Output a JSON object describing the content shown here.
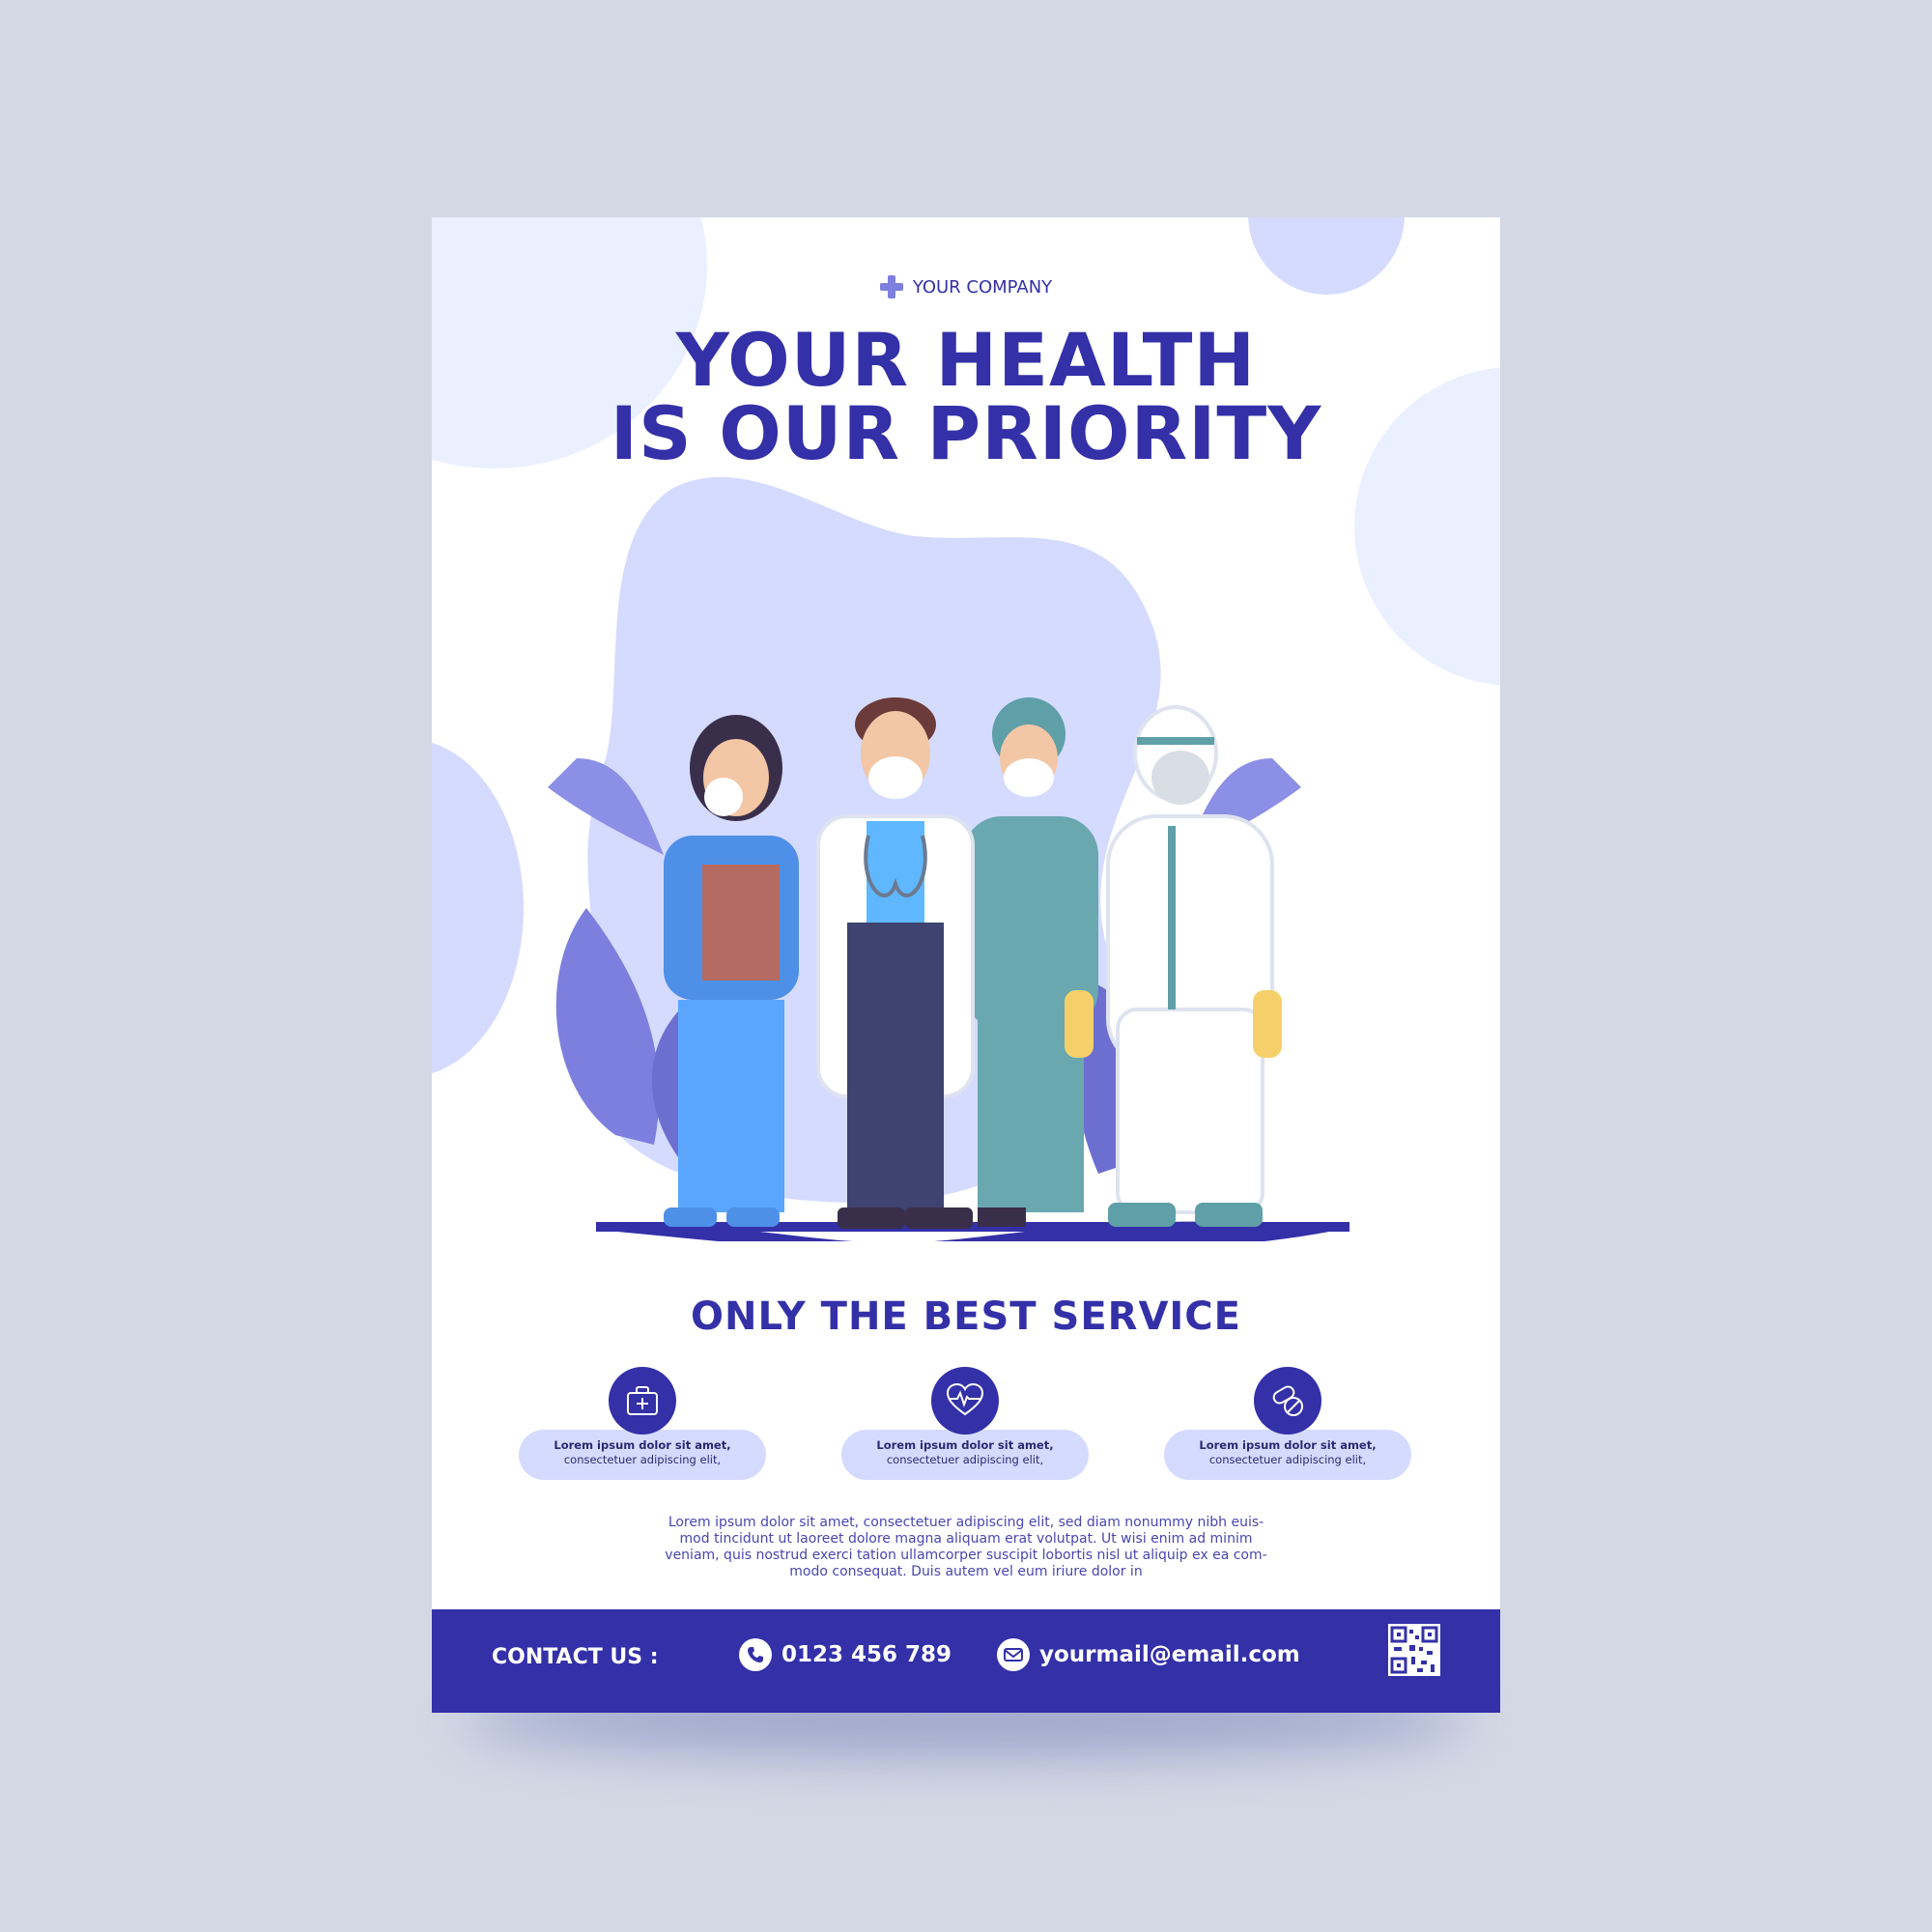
{
  "company": {
    "icon": "medical-cross-icon",
    "name": "YOUR COMPANY"
  },
  "headline": {
    "line1": "YOUR HEALTH",
    "line2": "IS OUR PRIORITY"
  },
  "illustration": {
    "description_icon": "medical-staff-illustration"
  },
  "subheading": "ONLY THE BEST SERVICE",
  "features": [
    {
      "icon": "first-aid-kit-icon",
      "line1": "Lorem ipsum dolor sit amet,",
      "line2": "consectetuer adipiscing elit,"
    },
    {
      "icon": "heartbeat-icon",
      "line1": "Lorem ipsum dolor sit amet,",
      "line2": "consectetuer adipiscing elit,"
    },
    {
      "icon": "pills-icon",
      "line1": "Lorem ipsum dolor sit amet,",
      "line2": "consectetuer adipiscing elit,"
    }
  ],
  "body_text": [
    "Lorem ipsum dolor sit amet, consectetuer adipiscing elit, sed diam nonummy nibh euis-",
    "mod tincidunt ut laoreet dolore magna aliquam erat volutpat. Ut wisi enim ad minim",
    "veniam, quis nostrud exerci tation ullamcorper suscipit lobortis nisl ut aliquip ex ea com-",
    "modo consequat. Duis autem vel eum iriure dolor in"
  ],
  "contact": {
    "label": "CONTACT US :",
    "phone_icon": "phone-icon",
    "phone": "0123 456 789",
    "email_icon": "envelope-icon",
    "email": "yourmail@email.com",
    "qr_icon": "qr-code-icon"
  },
  "colors": {
    "primary": "#3330a8",
    "light_lavender": "#d5dbff",
    "pale_blue": "#eaf0ff",
    "background": "#d3d8e4"
  }
}
